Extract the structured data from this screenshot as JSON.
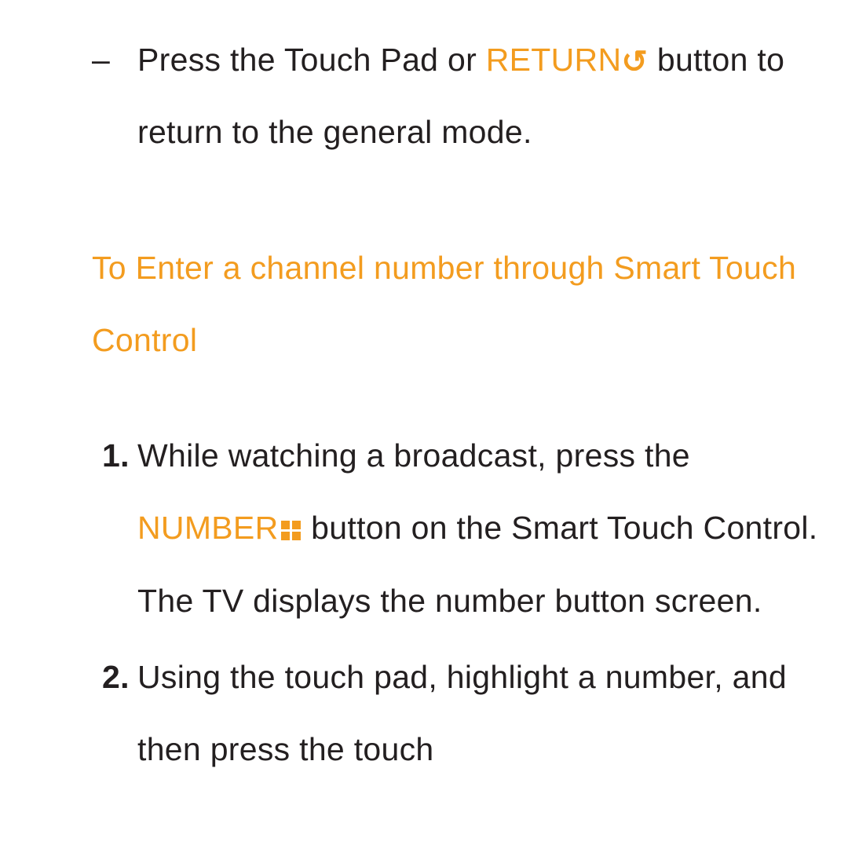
{
  "dash": "–",
  "bullet": {
    "text_before": "Press the Touch Pad or ",
    "button_label": "RETURN",
    "icon_name": "return-icon",
    "text_after": " button to return to the general mode."
  },
  "heading": "To Enter a channel number through Smart Touch Control",
  "steps": [
    {
      "num": "1.",
      "text_before": "While watching a broadcast, press the ",
      "button_label": "NUMBER",
      "icon_name": "number-pad-icon",
      "text_after": " button on the Smart Touch Control. The TV displays the number button screen."
    },
    {
      "num": "2.",
      "text_full": "Using the touch pad, highlight a number, and then press the touch"
    }
  ]
}
